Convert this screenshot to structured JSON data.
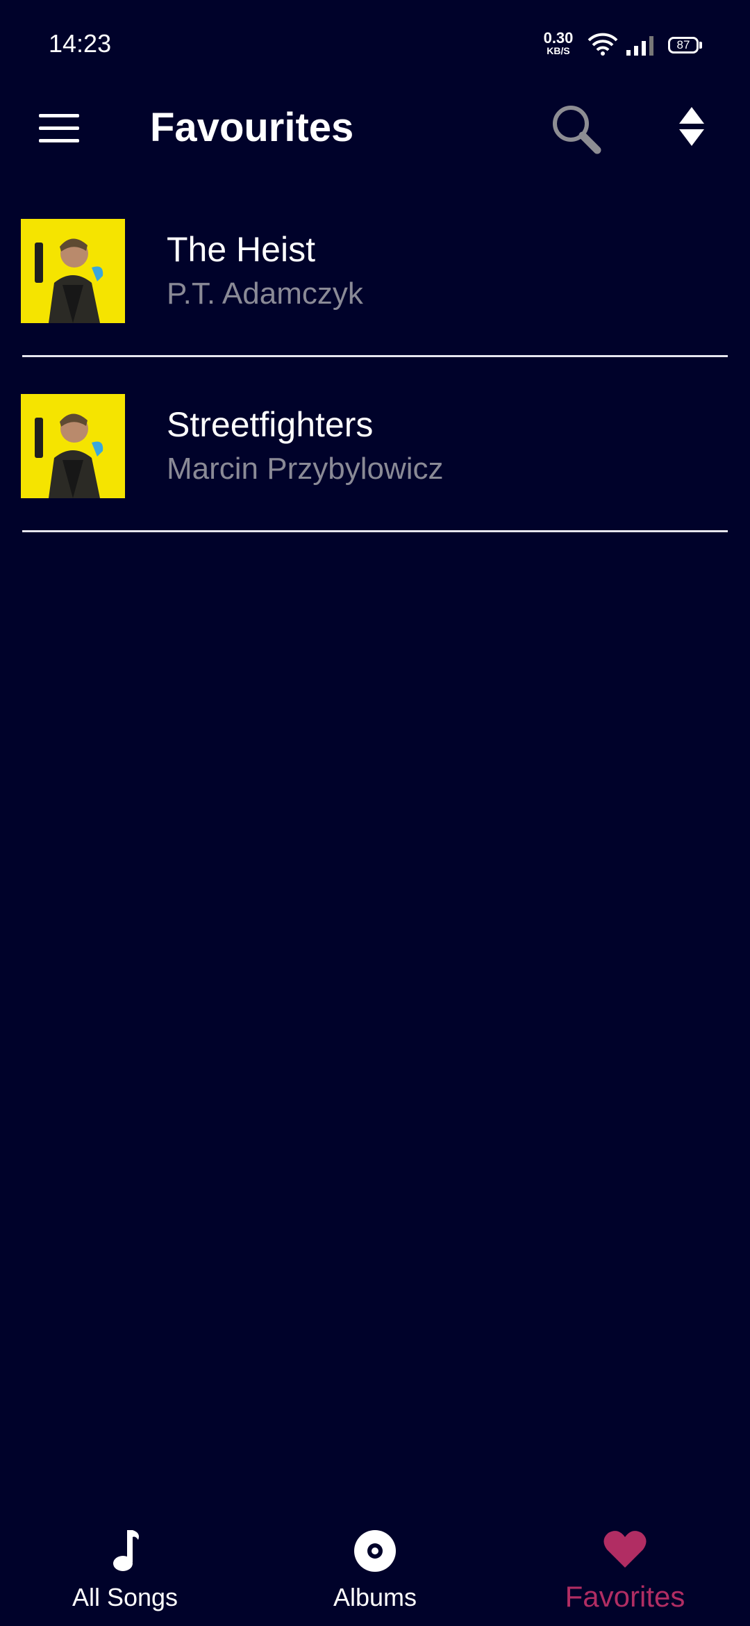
{
  "status_bar": {
    "time": "14:23",
    "net_speed_value": "0.30",
    "net_speed_unit": "KB/S",
    "battery_level": "87",
    "icons": [
      "wifi-icon",
      "signal-icon",
      "battery-icon"
    ]
  },
  "header": {
    "title": "Favourites",
    "icons": [
      "menu-icon",
      "search-icon",
      "sort-icon"
    ]
  },
  "songs": [
    {
      "title": "The Heist",
      "artist": "P.T. Adamczyk"
    },
    {
      "title": "Streetfighters",
      "artist": "Marcin Przybylowicz"
    }
  ],
  "bottom_nav": {
    "items": [
      {
        "label": "All Songs",
        "icon": "music-note-icon",
        "active": false
      },
      {
        "label": "Albums",
        "icon": "album-disc-icon",
        "active": false
      },
      {
        "label": "Favorites",
        "icon": "heart-icon",
        "active": true
      }
    ]
  },
  "colors": {
    "background": "#00022a",
    "accent": "#b12d63",
    "secondary_text": "#8a8a96",
    "album_art": "#f5e400"
  }
}
